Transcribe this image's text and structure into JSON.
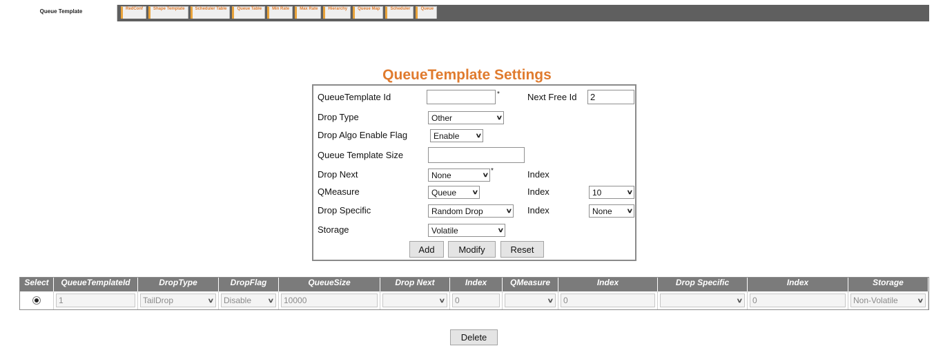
{
  "tabs": {
    "active": "Queue Template",
    "others": [
      "RedConf",
      "Shape Template",
      "Scheduler Table",
      "Queue Table",
      "Min Rate",
      "Max Rate",
      "Hierarchy",
      "Queue Map",
      "Scheduler",
      "Queue"
    ]
  },
  "form": {
    "title": "QueueTemplate Settings",
    "queue_template_id_label": "QueueTemplate Id",
    "queue_template_id_value": "",
    "next_free_id_label": "Next Free Id",
    "next_free_id_value": "2",
    "drop_type_label": "Drop Type",
    "drop_type_value": "Other",
    "drop_algo_label": "Drop Algo Enable Flag",
    "drop_algo_value": "Enable",
    "queue_template_size_label": "Queue Template Size",
    "queue_template_size_value": "",
    "drop_next_label": "Drop Next",
    "drop_next_value": "None",
    "index_label": "Index",
    "qmeasure_label": "QMeasure",
    "qmeasure_value": "Queue",
    "qmeasure_index_value": "10",
    "drop_specific_label": "Drop Specific",
    "drop_specific_value": "Random Drop",
    "drop_specific_index_value": "None",
    "storage_label": "Storage",
    "storage_value": "Volatile",
    "required_mark": "*",
    "add_button": "Add",
    "modify_button": "Modify",
    "reset_button": "Reset"
  },
  "table": {
    "headers": [
      "Select",
      "QueueTemplateId",
      "DropType",
      "DropFlag",
      "QueueSize",
      "Drop Next",
      "Index",
      "QMeasure",
      "Index",
      "Drop Specific",
      "Index",
      "Storage"
    ],
    "rows": [
      {
        "selected": true,
        "id": "1",
        "drop_type": "TailDrop",
        "drop_flag": "Disable",
        "queue_size": "10000",
        "drop_next": "",
        "drop_next_index": "0",
        "qmeasure": "",
        "qmeasure_index": "0",
        "drop_specific": "",
        "drop_specific_index": "0",
        "storage": "Non-Volatile"
      }
    ]
  },
  "delete_button": "Delete",
  "colors": {
    "accent_orange": "#e07b2e",
    "tabbar": "#5f5f5f",
    "table_header": "#7b7b7b"
  }
}
